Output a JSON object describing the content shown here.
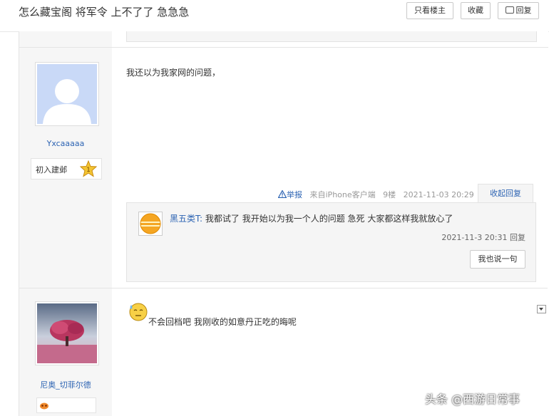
{
  "header": {
    "title": "怎么藏宝阁 将军令 上不了了 急急急",
    "buttons": {
      "only_op": "只看楼主",
      "favorite": "收藏",
      "reply": "回复"
    }
  },
  "posts": [
    {
      "username": "Yxcaaaaa",
      "level_badge": {
        "label": "初入建邺",
        "level": "1"
      },
      "content": "我还以为我家网的问题，",
      "meta": {
        "report": "举报",
        "source": "来自iPhone客户端",
        "floor": "9楼",
        "time": "2021-11-03 20:29"
      },
      "collapse_label": "收起回复",
      "replies": [
        {
          "name": "黑五类T:",
          "text": "我都试了 我开始以为我一个人的问题 急死 大家都这样我就放心了",
          "time": "2021-11-3 20:31",
          "reply_label": "回复"
        }
      ],
      "say_button": "我也说一句"
    },
    {
      "username": "尼奥_切菲尔德",
      "content": "不会回档吧 我刚收的如意丹正吃的晦呢"
    }
  ],
  "watermark": "头条 @西游日常事",
  "colors": {
    "link": "#2d64b3",
    "sidebar_bg": "#f6f6f6",
    "reply_bg": "#f5f5f5"
  }
}
